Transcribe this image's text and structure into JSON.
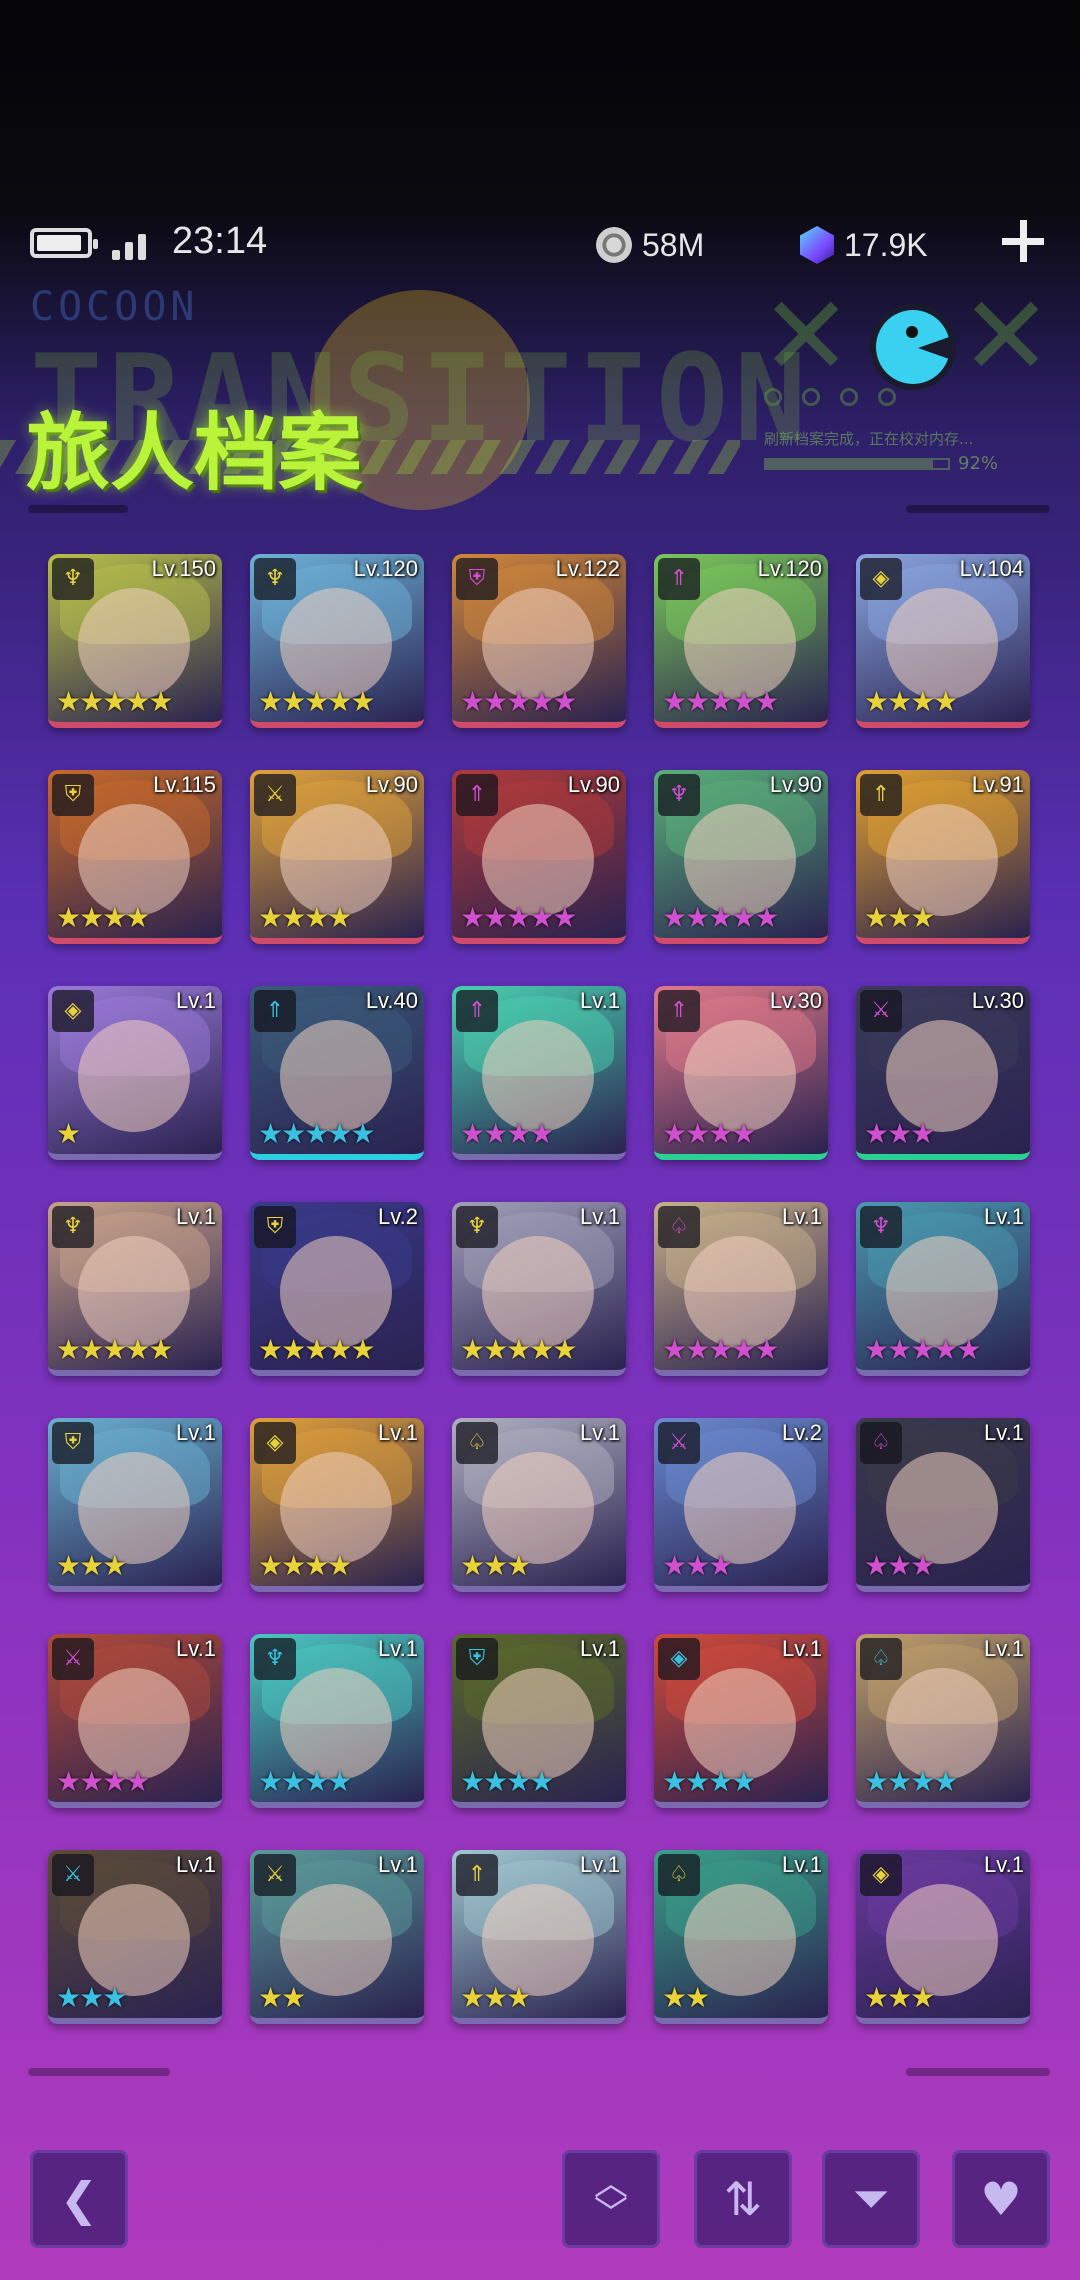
{
  "status_bar": {
    "time": "23:14",
    "coins": "58M",
    "gems": "17.9K"
  },
  "header": {
    "title": "旅人档案",
    "bg_text": "TRANSITION",
    "cocoon_text": "COCOON",
    "progress_text": "刷新档案完成，正在校对内存...",
    "progress_value": "92%",
    "progress_fraction": 0.92
  },
  "heroes": [
    {
      "level": "Lv.150",
      "stars": "★★★★★",
      "star_color": "#e8d23a",
      "class_icon": "bow-icon",
      "glyph": "♆",
      "tint": "#b7c04a",
      "edge": "#d04a6a"
    },
    {
      "level": "Lv.120",
      "stars": "★★★★★",
      "star_color": "#e8d23a",
      "class_icon": "bow-icon",
      "glyph": "♆",
      "tint": "#6db2d8",
      "edge": "#d04a6a"
    },
    {
      "level": "Lv.122",
      "stars": "★★★★★",
      "star_color": "#d050d0",
      "class_icon": "shield-icon",
      "glyph": "⛨",
      "tint": "#d0873a",
      "edge": "#d04a6a"
    },
    {
      "level": "Lv.120",
      "stars": "★★★★★",
      "star_color": "#d050d0",
      "class_icon": "arrow-up-icon",
      "glyph": "⇑",
      "tint": "#7ac85a",
      "edge": "#d04a6a"
    },
    {
      "level": "Lv.104",
      "stars": "★★★★",
      "star_color": "#e8d23a",
      "class_icon": "diamond-icon",
      "glyph": "◈",
      "tint": "#8aa6e0",
      "edge": "#d04a6a"
    },
    {
      "level": "Lv.115",
      "stars": "★★★★",
      "star_color": "#e8d23a",
      "class_icon": "shield-icon",
      "glyph": "⛨",
      "tint": "#c86a2a",
      "edge": "#d04a6a"
    },
    {
      "level": "Lv.90",
      "stars": "★★★★",
      "star_color": "#e8d23a",
      "class_icon": "swords-icon",
      "glyph": "⚔",
      "tint": "#e0a23a",
      "edge": "#d04a6a"
    },
    {
      "level": "Lv.90",
      "stars": "★★★★★",
      "star_color": "#d050d0",
      "class_icon": "arrow-up-icon",
      "glyph": "⇑",
      "tint": "#b03a3a",
      "edge": "#d04a6a"
    },
    {
      "level": "Lv.90",
      "stars": "★★★★★",
      "star_color": "#d050d0",
      "class_icon": "bow-icon",
      "glyph": "♆",
      "tint": "#5ab07a",
      "edge": "#d04a6a"
    },
    {
      "level": "Lv.91",
      "stars": "★★★",
      "star_color": "#e8d23a",
      "class_icon": "arrow-up-icon",
      "glyph": "⇑",
      "tint": "#e0a030",
      "edge": "#d04a6a"
    },
    {
      "level": "Lv.1",
      "stars": "★",
      "star_color": "#e8d23a",
      "class_icon": "diamond-icon",
      "glyph": "◈",
      "tint": "#9a7ad8",
      "edge": "#7a6ab0"
    },
    {
      "level": "Lv.40",
      "stars": "★★★★★",
      "star_color": "#3ac0e0",
      "class_icon": "arrow-up-icon",
      "glyph": "⇑",
      "tint": "#3a5a7a",
      "edge": "#2ad0e0"
    },
    {
      "level": "Lv.1",
      "stars": "★★★★",
      "star_color": "#d050d0",
      "class_icon": "arrow-up-icon",
      "glyph": "⇑",
      "tint": "#4ad0b0",
      "edge": "#7a6ab0"
    },
    {
      "level": "Lv.30",
      "stars": "★★★★",
      "star_color": "#d050d0",
      "class_icon": "arrow-up-icon",
      "glyph": "⇑",
      "tint": "#e07a8a",
      "edge": "#2ad090"
    },
    {
      "level": "Lv.30",
      "stars": "★★★",
      "star_color": "#d050d0",
      "class_icon": "swords-icon",
      "glyph": "⚔",
      "tint": "#3a3a5a",
      "edge": "#2ad090"
    },
    {
      "level": "Lv.1",
      "stars": "★★★★★",
      "star_color": "#e8d23a",
      "class_icon": "bow-icon",
      "glyph": "♆",
      "tint": "#c8a28a",
      "edge": "#7a6ab0"
    },
    {
      "level": "Lv.2",
      "stars": "★★★★★",
      "star_color": "#e8d23a",
      "class_icon": "shield-icon",
      "glyph": "⛨",
      "tint": "#3a3a8a",
      "edge": "#7a6ab0"
    },
    {
      "level": "Lv.1",
      "stars": "★★★★★",
      "star_color": "#e8d23a",
      "class_icon": "bow-icon",
      "glyph": "♆",
      "tint": "#a0a0b8",
      "edge": "#7a6ab0"
    },
    {
      "level": "Lv.1",
      "stars": "★★★★★",
      "star_color": "#d050d0",
      "class_icon": "spade-icon",
      "glyph": "♤",
      "tint": "#c8b08a",
      "edge": "#7a6ab0"
    },
    {
      "level": "Lv.1",
      "stars": "★★★★★",
      "star_color": "#d050d0",
      "class_icon": "bow-icon",
      "glyph": "♆",
      "tint": "#4a9ab0",
      "edge": "#7a6ab0"
    },
    {
      "level": "Lv.1",
      "stars": "★★★",
      "star_color": "#e8d23a",
      "class_icon": "shield-icon",
      "glyph": "⛨",
      "tint": "#6ab0d0",
      "edge": "#7a6ab0"
    },
    {
      "level": "Lv.1",
      "stars": "★★★★",
      "star_color": "#e8d23a",
      "class_icon": "diamond-icon",
      "glyph": "◈",
      "tint": "#e0a03a",
      "edge": "#7a6ab0"
    },
    {
      "level": "Lv.1",
      "stars": "★★★",
      "star_color": "#e8d23a",
      "class_icon": "spade-icon",
      "glyph": "♤",
      "tint": "#b0b0c0",
      "edge": "#7a6ab0"
    },
    {
      "level": "Lv.2",
      "stars": "★★★",
      "star_color": "#d050d0",
      "class_icon": "swords-icon",
      "glyph": "⚔",
      "tint": "#6a8ad0",
      "edge": "#7a6ab0"
    },
    {
      "level": "Lv.1",
      "stars": "★★★",
      "star_color": "#d050d0",
      "class_icon": "spade-icon",
      "glyph": "♤",
      "tint": "#3a3a4a",
      "edge": "#7a6ab0"
    },
    {
      "level": "Lv.1",
      "stars": "★★★★",
      "star_color": "#d050d0",
      "class_icon": "swords-icon",
      "glyph": "⚔",
      "tint": "#b04a3a",
      "edge": "#7a6ab0"
    },
    {
      "level": "Lv.1",
      "stars": "★★★★",
      "star_color": "#3ac0e0",
      "class_icon": "bow-icon",
      "glyph": "♆",
      "tint": "#4ac8c0",
      "edge": "#7a6ab0"
    },
    {
      "level": "Lv.1",
      "stars": "★★★★",
      "star_color": "#3ac0e0",
      "class_icon": "shield-icon",
      "glyph": "⛨",
      "tint": "#5a6a2a",
      "edge": "#7a6ab0"
    },
    {
      "level": "Lv.1",
      "stars": "★★★★",
      "star_color": "#3ac0e0",
      "class_icon": "diamond-icon",
      "glyph": "◈",
      "tint": "#d04a3a",
      "edge": "#7a6ab0"
    },
    {
      "level": "Lv.1",
      "stars": "★★★★",
      "star_color": "#3ac0e0",
      "class_icon": "spade-icon",
      "glyph": "♤",
      "tint": "#c0a06a",
      "edge": "#7a6ab0"
    },
    {
      "level": "Lv.1",
      "stars": "★★★",
      "star_color": "#3ac0e0",
      "class_icon": "swords-icon",
      "glyph": "⚔",
      "tint": "#5a4a3a",
      "edge": "#7a6ab0"
    },
    {
      "level": "Lv.1",
      "stars": "★★",
      "star_color": "#e8d23a",
      "class_icon": "swords-icon",
      "glyph": "⚔",
      "tint": "#5a9a9a",
      "edge": "#7a6ab0"
    },
    {
      "level": "Lv.1",
      "stars": "★★★",
      "star_color": "#e8d23a",
      "class_icon": "arrow-up-icon",
      "glyph": "⇑",
      "tint": "#a0c8d0",
      "edge": "#7a6ab0"
    },
    {
      "level": "Lv.1",
      "stars": "★★",
      "star_color": "#e8d23a",
      "class_icon": "spade-icon",
      "glyph": "♤",
      "tint": "#3aa08a",
      "edge": "#7a6ab0"
    },
    {
      "level": "Lv.1",
      "stars": "★★★",
      "star_color": "#e8d23a",
      "class_icon": "diamond-icon",
      "glyph": "◈",
      "tint": "#6a3aa0",
      "edge": "#7a6ab0"
    }
  ],
  "toolbar": {
    "back_icon": "chevron-left-icon",
    "collapse_icon": "expand-collapse-icon",
    "sort_icon": "sort-icon",
    "filter_icon": "filter-icon",
    "favorite_icon": "heart-icon"
  }
}
